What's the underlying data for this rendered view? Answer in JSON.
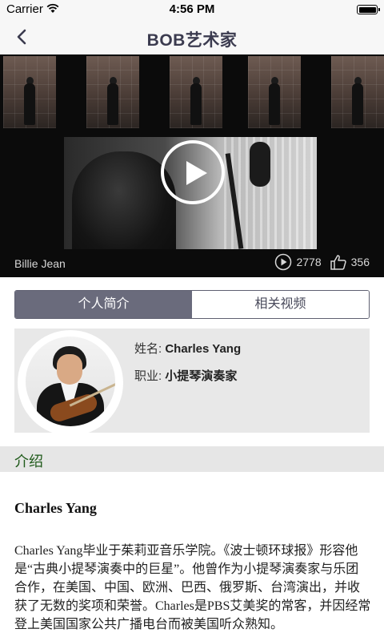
{
  "status_bar": {
    "carrier": "Carrier",
    "time": "4:56 PM"
  },
  "nav": {
    "title": "BOB艺术家"
  },
  "video": {
    "caption": "Billie Jean",
    "plays": "2778",
    "likes": "356"
  },
  "tabs": [
    {
      "label": "个人简介",
      "active": true
    },
    {
      "label": "相关视频",
      "active": false
    }
  ],
  "profile": {
    "name_label": "姓名:",
    "name": "Charles Yang",
    "job_label": "职业:",
    "job": "小提琴演奏家"
  },
  "section": {
    "title": "介绍"
  },
  "intro": {
    "heading": "Charles Yang",
    "body": "Charles Yang毕业于茱莉亚音乐学院。《波士顿环球报》形容他是“古典小提琴演奏中的巨星”。他曾作为小提琴演奏家与乐团合作，在美国、中国、欧洲、巴西、俄罗斯、台湾演出，并收获了无数的奖项和荣誉。Charles是PBS艾美奖的常客，并因经常登上美国国家公共广播电台而被美国听众熟知。"
  },
  "colors": {
    "nav_title": "#3b3b4f",
    "tab_active": "#6a6b7c",
    "section_title": "#1f5a1a"
  }
}
